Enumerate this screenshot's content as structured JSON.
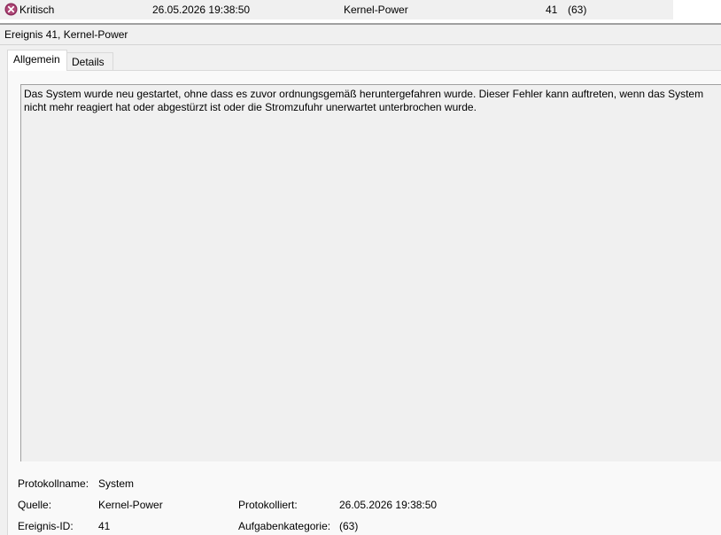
{
  "event_row": {
    "level_icon": "critical-x-icon",
    "level": "Kritisch",
    "datetime": "26.05.2026 19:38:50",
    "source": "Kernel-Power",
    "event_id": "41",
    "task_category": "(63)"
  },
  "detail": {
    "title": "Ereignis 41, Kernel-Power",
    "tabs": [
      {
        "label": "Allgemein",
        "active": true
      },
      {
        "label": "Details",
        "active": false
      }
    ],
    "description": "Das System wurde neu gestartet, ohne dass es zuvor ordnungsgemäß heruntergefahren wurde. Dieser Fehler kann auftreten, wenn das System nicht mehr reagiert hat oder abgestürzt ist oder die Stromzufuhr unerwartet unterbrochen wurde.",
    "properties": {
      "log_name_label": "Protokollname:",
      "log_name_value": "System",
      "source_label": "Quelle:",
      "source_value": "Kernel-Power",
      "logged_label": "Protokolliert:",
      "logged_value": "26.05.2026 19:38:50",
      "event_id_label": "Ereignis-ID:",
      "event_id_value": "41",
      "task_category_label": "Aufgabenkategorie:",
      "task_category_value": "(63)"
    }
  },
  "colors": {
    "critical_icon": "#8b2a5a",
    "panel_background": "#f0f0f0",
    "divider": "#a0a0a0"
  }
}
